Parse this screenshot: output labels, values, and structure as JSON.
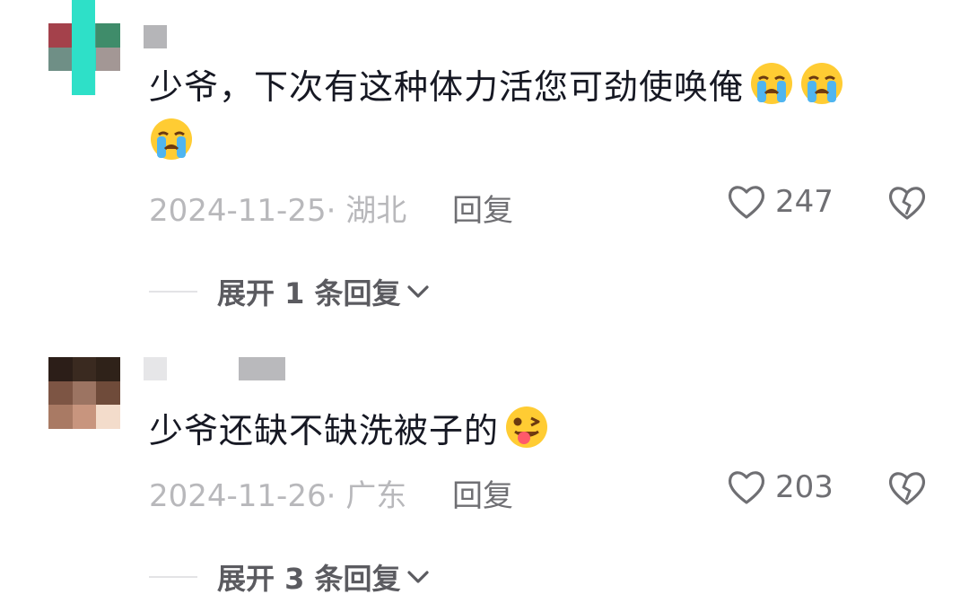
{
  "comments": [
    {
      "text": "少爷，下次有这种体力活您可劲使唤俺",
      "emojis": [
        "crying-face",
        "crying-face",
        "crying-face"
      ],
      "date_location": "2024-11-25· 湖北",
      "reply_label": "回复",
      "like_count": "247",
      "expand_label": "展开 1 条回复"
    },
    {
      "text": "少爷还缺不缺洗被子的",
      "emojis": [
        "winking-tongue-face"
      ],
      "date_location": "2024-11-26· 广东",
      "reply_label": "回复",
      "like_count": "203",
      "expand_label": "展开 3 条回复"
    }
  ],
  "colors": {
    "text": "#161823",
    "meta": "#b8b8bb",
    "action": "#6f6f73",
    "expand": "#5b5b60",
    "avatar1_accent": "#2ee0c8"
  }
}
